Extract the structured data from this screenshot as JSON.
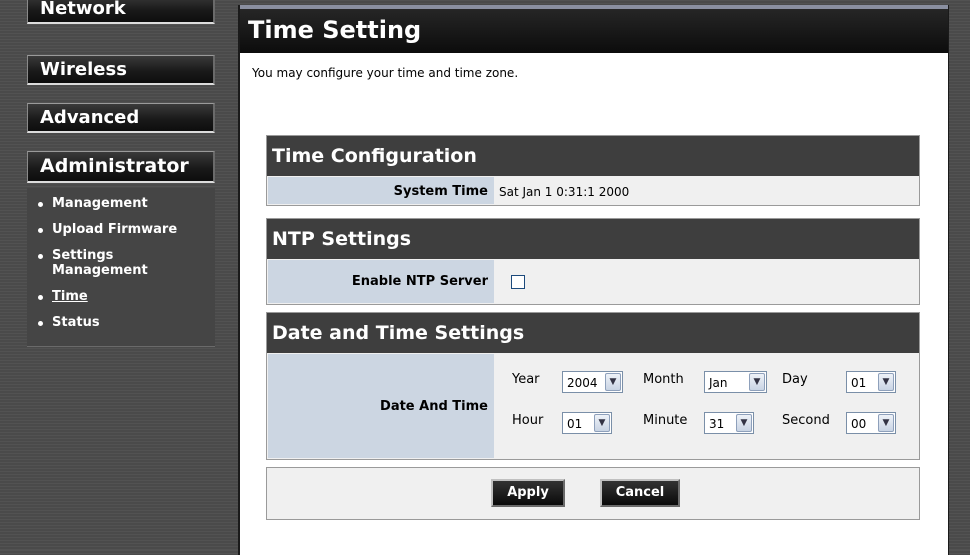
{
  "nav": {
    "network": "Network",
    "wireless": "Wireless",
    "advanced": "Advanced",
    "administrator": "Administrator",
    "submenu": [
      "Management",
      "Upload Firmware",
      "Settings Management",
      "Time",
      "Status"
    ],
    "active": "Time"
  },
  "page": {
    "title": "Time Setting",
    "intro": "You may configure your time and time zone."
  },
  "time_config": {
    "heading": "Time Configuration",
    "system_time_label": "System Time",
    "system_time_value": "Sat Jan 1 0:31:1 2000"
  },
  "ntp": {
    "heading": "NTP Settings",
    "enable_label": "Enable NTP Server",
    "enabled": false
  },
  "datetime": {
    "heading": "Date and Time Settings",
    "label": "Date And Time",
    "year_label": "Year",
    "year_value": "2004",
    "month_label": "Month",
    "month_value": "Jan",
    "day_label": "Day",
    "day_value": "01",
    "hour_label": "Hour",
    "hour_value": "01",
    "minute_label": "Minute",
    "minute_value": "31",
    "second_label": "Second",
    "second_value": "00"
  },
  "actions": {
    "apply": "Apply",
    "cancel": "Cancel"
  },
  "icons": {
    "dropdown_arrow": "chevron-down-icon",
    "bullet": "bullet-icon"
  },
  "colors": {
    "page_bg": "#4a4a4a",
    "section_header": "#3e3e3e",
    "label_cell": "#ccd6e2",
    "row_bg": "#f0f0f0"
  }
}
